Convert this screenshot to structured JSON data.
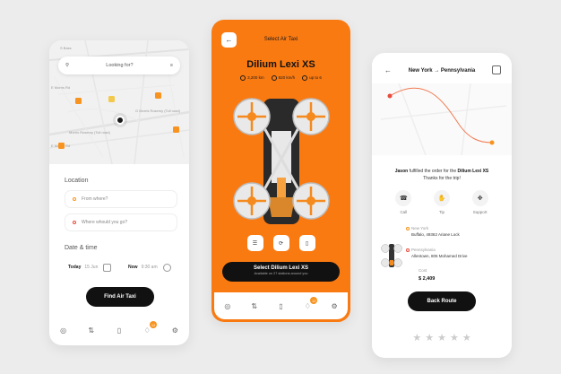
{
  "colors": {
    "accent": "#fa7a12",
    "dark": "#111111",
    "background": "#ececec"
  },
  "left": {
    "search_placeholder": "Looking for?",
    "map_labels": [
      "S Bass",
      "E Morris Rd",
      "W Morris Rd",
      "Buffalo",
      "S Mogls Bay",
      "E Morris Rd",
      "G Morris Rosemy (Toll road)",
      "Morris Rosemy (Toll road)",
      "E Morris Rd"
    ],
    "location_title": "Location",
    "from_placeholder": "From where?",
    "to_placeholder": "Where whould you go?",
    "datetime_title": "Date & time",
    "date_label": "Today",
    "date_value": "15 Jun",
    "time_label": "Now",
    "time_value": "9:30 am",
    "cta": "Find Air Taxi",
    "badge": "12"
  },
  "mid": {
    "title": "Select Air Taxi",
    "model": "Dilium Lexi XS",
    "stats": [
      "3,200 km",
      "820 km/h",
      "up to 6"
    ],
    "select_label": "Select Dilium Lexi XS",
    "select_sub": "Available on 27 stations around you",
    "badge": "12"
  },
  "right": {
    "origin": "New York",
    "arrow": "→",
    "destination": "Pennsylvania",
    "fulfil_name": "Jason",
    "fulfil_mid": "fulfilled the order for the",
    "fulfil_model": "Dilium Lexi XS",
    "fulfil_thanks": "Thanks for the trip!",
    "actions": [
      "Call",
      "Tip",
      "Support"
    ],
    "stop1_city": "New York",
    "stop1_addr": "Buffalo, 49362 Ariane Lock",
    "stop2_city": "Pennsylvania",
    "stop2_addr": "Allentown, 805 Mohamed Drive",
    "cost_label": "Cost",
    "cost_value": "$ 2,409",
    "cta": "Back Route",
    "rating": 0
  }
}
